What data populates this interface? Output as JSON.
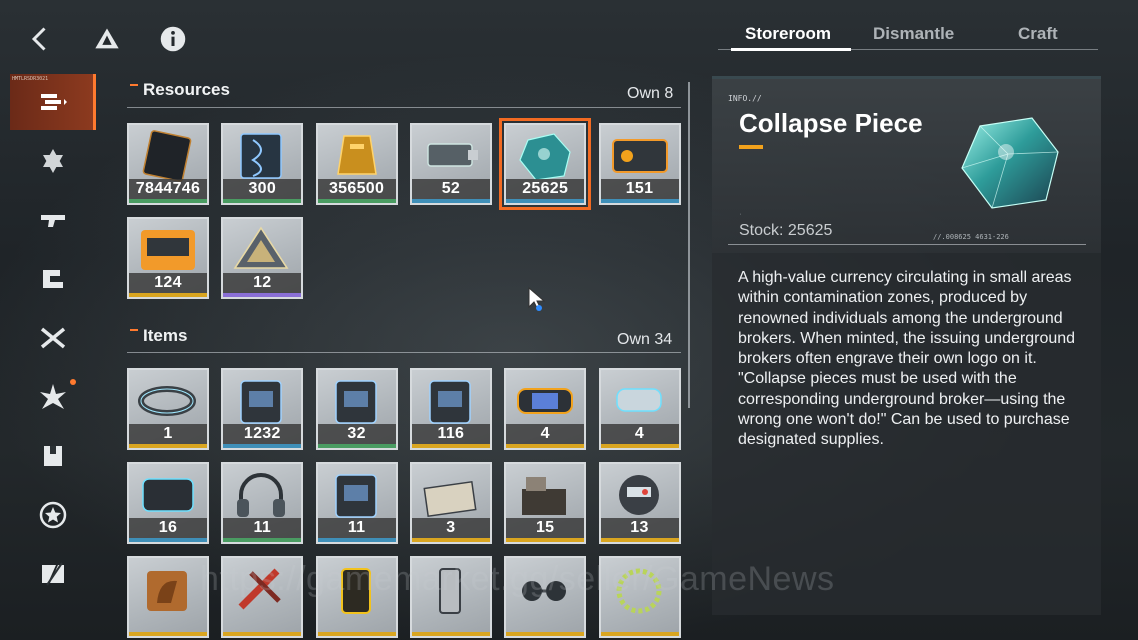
{
  "topbar": {
    "back_icon": "chevron-left-icon",
    "drive_icon": "triangle-logo-icon",
    "info_icon": "info-circle-icon"
  },
  "rail": {
    "items": [
      {
        "name": "rail-item-storage",
        "icon": "stack-icon",
        "active": true,
        "tag": "HMTLRSDR3021"
      },
      {
        "name": "rail-item-star",
        "icon": "hexagram-icon"
      },
      {
        "name": "rail-item-weapon",
        "icon": "gun-icon"
      },
      {
        "name": "rail-item-gear",
        "icon": "gear-parts-icon"
      },
      {
        "name": "rail-item-cross",
        "icon": "crossed-blades-icon"
      },
      {
        "name": "rail-item-burst",
        "icon": "burst-icon",
        "badge": true
      },
      {
        "name": "rail-item-box",
        "icon": "box-icon"
      },
      {
        "name": "rail-item-emblem",
        "icon": "star-circle-icon"
      },
      {
        "name": "rail-item-logo",
        "icon": "slash-logo-icon"
      }
    ]
  },
  "resources": {
    "title": "Resources",
    "own": "Own 8",
    "items": [
      {
        "count": "7844746",
        "rarity": "#4a9c62",
        "icon": "dark-ticket-icon"
      },
      {
        "count": "300",
        "rarity": "#4a9c62",
        "icon": "dna-card-icon"
      },
      {
        "count": "356500",
        "rarity": "#4a9c62",
        "icon": "gold-bar-icon"
      },
      {
        "count": "52",
        "rarity": "#3f8fb8",
        "icon": "usb-key-icon"
      },
      {
        "count": "25625",
        "rarity": "#3f8fb8",
        "icon": "crystal-icon",
        "selected": true
      },
      {
        "count": "151",
        "rarity": "#3f8fb8",
        "icon": "orange-card-icon"
      },
      {
        "count": "124",
        "rarity": "#d9a520",
        "icon": "orange-pass-icon"
      },
      {
        "count": "12",
        "rarity": "#8a6fd6",
        "icon": "triangle-chip-icon"
      }
    ]
  },
  "items": {
    "title": "Items",
    "own": "Own 34",
    "list": [
      {
        "count": "1",
        "rarity": "#d9a520",
        "icon": "bracelet-icon"
      },
      {
        "count": "1232",
        "rarity": "#3f8fb8",
        "icon": "blue-chip-card-icon"
      },
      {
        "count": "32",
        "rarity": "#4a9c62",
        "icon": "green-chip-card-icon"
      },
      {
        "count": "116",
        "rarity": "#d9a520",
        "icon": "x-card-icon"
      },
      {
        "count": "4",
        "rarity": "#d9a520",
        "icon": "handheld-console-icon"
      },
      {
        "count": "4",
        "rarity": "#d9a520",
        "icon": "vr-headset-icon"
      },
      {
        "count": "16",
        "rarity": "#3f8fb8",
        "icon": "game-console-icon"
      },
      {
        "count": "11",
        "rarity": "#4a9c62",
        "icon": "headphones-icon"
      },
      {
        "count": "11",
        "rarity": "#3f8fb8",
        "icon": "blue-card-icon"
      },
      {
        "count": "3",
        "rarity": "#d9a520",
        "icon": "cards-bundle-icon"
      },
      {
        "count": "15",
        "rarity": "#d9a520",
        "icon": "stove-icon"
      },
      {
        "count": "13",
        "rarity": "#d9a520",
        "icon": "robot-icon"
      },
      {
        "count": "",
        "rarity": "#d9a520",
        "icon": "horse-block-icon"
      },
      {
        "count": "",
        "rarity": "#d9a520",
        "icon": "tool-icon"
      },
      {
        "count": "",
        "rarity": "#d9a520",
        "icon": "can-icon"
      },
      {
        "count": "",
        "rarity": "#d9a520",
        "icon": "lighter-icon"
      },
      {
        "count": "",
        "rarity": "#d9a520",
        "icon": "glasses-icon"
      },
      {
        "count": "",
        "rarity": "#d9a520",
        "icon": "wreath-icon"
      }
    ]
  },
  "tabs": [
    "Storeroom",
    "Dismantle",
    "Craft"
  ],
  "detail": {
    "tag": "INFO.//",
    "name": "Collapse Piece",
    "stock": "Stock: 25625",
    "code": "//.008625  4631-226",
    "description": "A high-value currency circulating in small areas within contamination zones, produced by renowned individuals among the underground brokers. When minted, the issuing underground brokers often engrave their own logo on it. \"Collapse pieces must be used with the corresponding underground broker—using the wrong one won't do!\" Can be used to purchase designated supplies."
  },
  "watermark": "https://gamemarket.gg/seller/GameNews",
  "colors": {
    "accent": "#ff7a2f",
    "gold": "#f2a21c",
    "selected_outline": "#f26a22"
  }
}
